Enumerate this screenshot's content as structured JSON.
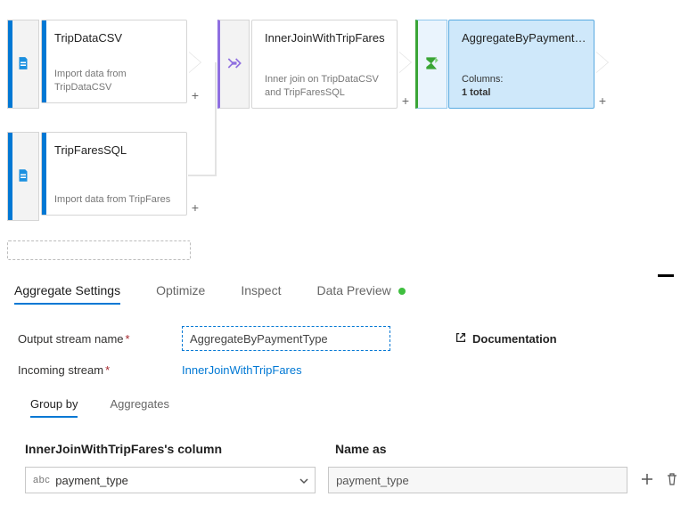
{
  "canvas": {
    "nodes": {
      "tripdata": {
        "title": "TripDataCSV",
        "desc": "Import data from TripDataCSV"
      },
      "tripfares": {
        "title": "TripFaresSQL",
        "desc": "Import data from TripFares"
      },
      "join": {
        "title": "InnerJoinWithTripFares",
        "desc": "Inner join on TripDataCSV and TripFaresSQL"
      },
      "aggregate": {
        "title": "AggregateByPaymentTy...",
        "columns_label": "Columns:",
        "columns_value": "1 total"
      }
    }
  },
  "settings": {
    "tabs": {
      "agg": "Aggregate Settings",
      "optimize": "Optimize",
      "inspect": "Inspect",
      "preview": "Data Preview"
    },
    "output_label": "Output stream name",
    "output_value": "AggregateByPaymentType",
    "incoming_label": "Incoming stream",
    "incoming_value": "InnerJoinWithTripFares",
    "documentation": "Documentation",
    "subtabs": {
      "groupby": "Group by",
      "aggregates": "Aggregates"
    },
    "column_header": "InnerJoinWithTripFares's column",
    "nameas_header": "Name as",
    "column_type_prefix": "abc",
    "column_value": "payment_type",
    "nameas_value": "payment_type"
  }
}
